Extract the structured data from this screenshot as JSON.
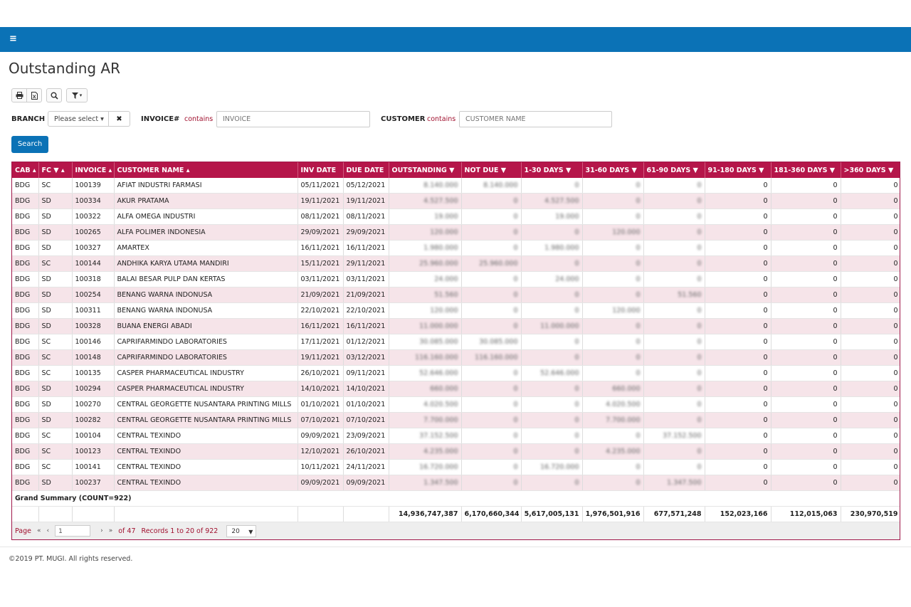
{
  "app": {
    "menu_icon": "≡",
    "title": "Outstanding AR"
  },
  "toolbar": {
    "print_icon": "🖶",
    "excel_icon": "🗎",
    "search_icon": "🔍",
    "filter_icon": "▼▾"
  },
  "filters": {
    "branch_label": "BRANCH",
    "branch_value": "Please select ▾",
    "clear_label": "✖",
    "invoice_label": "INVOICE#",
    "invoice_contains": "contains",
    "invoice_placeholder": "INVOICE",
    "customer_label": "CUSTOMER",
    "customer_contains": "contains",
    "customer_placeholder": "CUSTOMER NAME",
    "search_label": "Search"
  },
  "table": {
    "headers": [
      "CAB ▴",
      "FC ▼ ▴",
      "INVOICE ▴",
      "CUSTOMER NAME ▴",
      "INV DATE",
      "DUE DATE",
      "OUTSTANDING ▼",
      "NOT DUE ▼",
      "1-30 DAYS ▼",
      "31-60 DAYS ▼",
      "61-90 DAYS ▼",
      "91-180 DAYS ▼",
      "181-360 DAYS ▼",
      ">360 DAYS ▼"
    ],
    "rows": [
      [
        "BDG",
        "SC",
        "100139",
        "AFIAT INDUSTRI FARMASI",
        "05/11/2021",
        "05/12/2021",
        "8.140.000",
        "8.140.000",
        "0",
        "0",
        "0",
        "0",
        "0",
        "0"
      ],
      [
        "BDG",
        "SD",
        "100334",
        "AKUR PRATAMA",
        "19/11/2021",
        "19/11/2021",
        "4.527.500",
        "0",
        "4.527.500",
        "0",
        "0",
        "0",
        "0",
        "0"
      ],
      [
        "BDG",
        "SD",
        "100322",
        "ALFA OMEGA INDUSTRI",
        "08/11/2021",
        "08/11/2021",
        "19.000",
        "0",
        "19.000",
        "0",
        "0",
        "0",
        "0",
        "0"
      ],
      [
        "BDG",
        "SD",
        "100265",
        "ALFA POLIMER INDONESIA",
        "29/09/2021",
        "29/09/2021",
        "120.000",
        "0",
        "0",
        "120.000",
        "0",
        "0",
        "0",
        "0"
      ],
      [
        "BDG",
        "SD",
        "100327",
        "AMARTEX",
        "16/11/2021",
        "16/11/2021",
        "1.980.000",
        "0",
        "1.980.000",
        "0",
        "0",
        "0",
        "0",
        "0"
      ],
      [
        "BDG",
        "SC",
        "100144",
        "ANDHIKA KARYA UTAMA MANDIRI",
        "15/11/2021",
        "29/11/2021",
        "25.960.000",
        "25.960.000",
        "0",
        "0",
        "0",
        "0",
        "0",
        "0"
      ],
      [
        "BDG",
        "SD",
        "100318",
        "BALAI BESAR PULP DAN KERTAS",
        "03/11/2021",
        "03/11/2021",
        "24.000",
        "0",
        "24.000",
        "0",
        "0",
        "0",
        "0",
        "0"
      ],
      [
        "BDG",
        "SD",
        "100254",
        "BENANG WARNA INDONUSA",
        "21/09/2021",
        "21/09/2021",
        "51.560",
        "0",
        "0",
        "0",
        "51.560",
        "0",
        "0",
        "0"
      ],
      [
        "BDG",
        "SD",
        "100311",
        "BENANG WARNA INDONUSA",
        "22/10/2021",
        "22/10/2021",
        "120.000",
        "0",
        "0",
        "120.000",
        "0",
        "0",
        "0",
        "0"
      ],
      [
        "BDG",
        "SD",
        "100328",
        "BUANA ENERGI ABADI",
        "16/11/2021",
        "16/11/2021",
        "11.000.000",
        "0",
        "11.000.000",
        "0",
        "0",
        "0",
        "0",
        "0"
      ],
      [
        "BDG",
        "SC",
        "100146",
        "CAPRIFARMINDO LABORATORIES",
        "17/11/2021",
        "01/12/2021",
        "30.085.000",
        "30.085.000",
        "0",
        "0",
        "0",
        "0",
        "0",
        "0"
      ],
      [
        "BDG",
        "SC",
        "100148",
        "CAPRIFARMINDO LABORATORIES",
        "19/11/2021",
        "03/12/2021",
        "116.160.000",
        "116.160.000",
        "0",
        "0",
        "0",
        "0",
        "0",
        "0"
      ],
      [
        "BDG",
        "SC",
        "100135",
        "CASPER PHARMACEUTICAL INDUSTRY",
        "26/10/2021",
        "09/11/2021",
        "52.646.000",
        "0",
        "52.646.000",
        "0",
        "0",
        "0",
        "0",
        "0"
      ],
      [
        "BDG",
        "SD",
        "100294",
        "CASPER PHARMACEUTICAL INDUSTRY",
        "14/10/2021",
        "14/10/2021",
        "660.000",
        "0",
        "0",
        "660.000",
        "0",
        "0",
        "0",
        "0"
      ],
      [
        "BDG",
        "SD",
        "100270",
        "CENTRAL GEORGETTE NUSANTARA PRINTING MILLS",
        "01/10/2021",
        "01/10/2021",
        "4.020.500",
        "0",
        "0",
        "4.020.500",
        "0",
        "0",
        "0",
        "0"
      ],
      [
        "BDG",
        "SD",
        "100282",
        "CENTRAL GEORGETTE NUSANTARA PRINTING MILLS",
        "07/10/2021",
        "07/10/2021",
        "7.700.000",
        "0",
        "0",
        "7.700.000",
        "0",
        "0",
        "0",
        "0"
      ],
      [
        "BDG",
        "SC",
        "100104",
        "CENTRAL TEXINDO",
        "09/09/2021",
        "23/09/2021",
        "37.152.500",
        "0",
        "0",
        "0",
        "37.152.500",
        "0",
        "0",
        "0"
      ],
      [
        "BDG",
        "SC",
        "100123",
        "CENTRAL TEXINDO",
        "12/10/2021",
        "26/10/2021",
        "4.235.000",
        "0",
        "0",
        "4.235.000",
        "0",
        "0",
        "0",
        "0"
      ],
      [
        "BDG",
        "SC",
        "100141",
        "CENTRAL TEXINDO",
        "10/11/2021",
        "24/11/2021",
        "16.720.000",
        "0",
        "16.720.000",
        "0",
        "0",
        "0",
        "0",
        "0"
      ],
      [
        "BDG",
        "SD",
        "100237",
        "CENTRAL TEXINDO",
        "09/09/2021",
        "09/09/2021",
        "1.347.500",
        "0",
        "0",
        "0",
        "1.347.500",
        "0",
        "0",
        "0"
      ]
    ],
    "summary_title": "Grand Summary (COUNT=922)",
    "summary_values": [
      "14,936,747,387",
      "6,170,660,344",
      "5,617,005,131",
      "1,976,501,916",
      "677,571,248",
      "152,023,166",
      "112,015,063",
      "230,970,519"
    ]
  },
  "pager": {
    "page_label": "Page",
    "first": "«",
    "prev": "‹",
    "page_value": "1",
    "next": "›",
    "last": "»",
    "of_label": "of 47",
    "records_label": "Records 1 to 20 of 922",
    "page_size": "20"
  },
  "footer": {
    "copyright": "©2019 PT. MUGI. All rights reserved."
  }
}
